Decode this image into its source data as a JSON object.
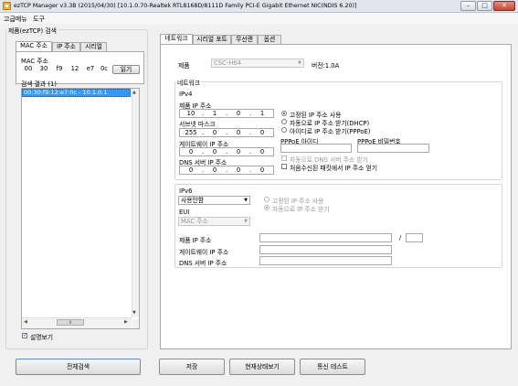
{
  "window": {
    "title": "ezTCP Manager v3.3B (2015/04/30) [10.1.0.70-Realtek RTL8168D/8111D Family PCI-E Gigabit Ethernet NIC(NDIS 6.20)]"
  },
  "menu": [
    "고급메뉴",
    "도구"
  ],
  "left": {
    "group_title": "제품(ezTCP) 검색",
    "tabs": [
      "MAC 주소",
      "IP 주소",
      "시리얼"
    ],
    "mac_label": "MAC 주소",
    "mac": [
      "00",
      "30",
      "f9",
      "12",
      "e7",
      "0c"
    ],
    "read_button": "읽기",
    "result_label": "검색 결과 (1)",
    "result_item": "00:30:f9:12:e7:0c - 10.1.0.1",
    "show_comment_label": "설명보기",
    "scroll_indicator": "Ⅲ"
  },
  "right": {
    "tabs": [
      "네트워크",
      "시리얼 포트",
      "무선랜",
      "옵션"
    ],
    "product_label": "제품",
    "product_value": "CSC-H64",
    "version_label": "버전:1.0A",
    "network_label": "네트워크",
    "ipv4": {
      "title": "IPv4",
      "ip_label": "제품 IP 주소",
      "ip": [
        "10",
        "1",
        "0",
        "1"
      ],
      "mask_label": "서브넷 마스크",
      "mask": [
        "255",
        "0",
        "0",
        "0"
      ],
      "gateway_label": "게이트웨이 IP 주소",
      "gateway": [
        "0",
        "0",
        "0",
        "0"
      ],
      "dns_label": "DNS 서버 IP 주소",
      "dns": [
        "0",
        "0",
        "0",
        "0"
      ],
      "radio_static": "고정된 IP 주소 사용",
      "radio_dhcp": "자동으로 IP 주소 받기(DHCP)",
      "radio_pppoe": "아이디로 IP 주소 받기(PPPoE)",
      "pppoe_id_label": "PPPoE 아이디",
      "pppoe_pw_label": "PPPoE 비밀번호",
      "auto_dns_label": "자동으로 DNS 서버 주소 받기",
      "first_packet_label": "처음수신된 패킷에서 IP 주소 얻기"
    },
    "ipv6": {
      "title": "IPv6",
      "mode_value": "사용안함",
      "radio_static": "고정된 IP 주소 사용",
      "radio_auto": "자동으로 IP 주소 받기",
      "eui_label": "EUI",
      "eui_value": "MAC 주소",
      "ip_label": "제품 IP 주소",
      "prefix_separator": "/",
      "gateway_label": "게이트웨이 IP 주소",
      "dns_label": "DNS 서버 IP 주소"
    }
  },
  "buttons": {
    "search_all": "전체검색",
    "save": "저장",
    "status": "현재상태보기",
    "comm_test": "통신 테스트"
  },
  "colors": {
    "selection": "#3399ff",
    "accent_border": "#ff0000"
  }
}
